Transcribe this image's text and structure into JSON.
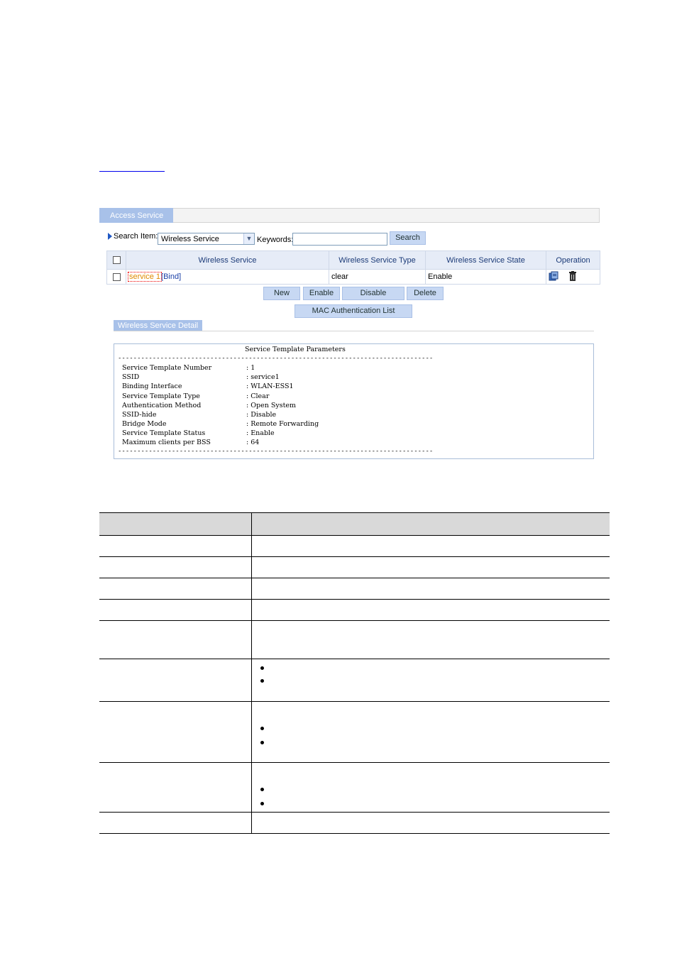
{
  "access_service": {
    "tab_label": "Access Service",
    "search_item_label": "Search Item:",
    "search_item_value": "Wireless Service",
    "keywords_label": "Keywords:",
    "keywords_value": "",
    "search_button": "Search",
    "table": {
      "headers": [
        "Wireless Service",
        "Wireless Service Type",
        "Wireless Service State",
        "Operation"
      ],
      "rows": [
        {
          "service_name": "service 1",
          "bind_label": "[Bind]",
          "type": "clear",
          "state": "Enable"
        }
      ]
    },
    "buttons": {
      "new": "New",
      "enable": "Enable",
      "disable": "Disable",
      "delete": "Delete",
      "mac_list": "MAC Authentication List"
    }
  },
  "detail": {
    "tab_label": "Wireless Service Detail",
    "title": "Service Template Parameters",
    "params": [
      {
        "name": "Service Template Number",
        "value": ": 1"
      },
      {
        "name": "SSID",
        "value": ": service1"
      },
      {
        "name": "Binding Interface",
        "value": ": WLAN-ESS1"
      },
      {
        "name": "Service Template Type",
        "value": ": Clear"
      },
      {
        "name": "Authentication Method",
        "value": ": Open System"
      },
      {
        "name": "SSID-hide",
        "value": ": Disable"
      },
      {
        "name": "Bridge Mode",
        "value": ": Remote Forwarding"
      },
      {
        "name": "Service Template Status",
        "value": ": Enable"
      },
      {
        "name": "Maximum clients per BSS",
        "value": ": 64"
      }
    ],
    "separator": "----------------------------------------------------------------------------------"
  },
  "icons": {
    "operation_edit": "summary-icon",
    "operation_delete": "trash-icon",
    "search_arrow": "triangle-right-icon",
    "select_arrow": "chevron-down-icon"
  }
}
